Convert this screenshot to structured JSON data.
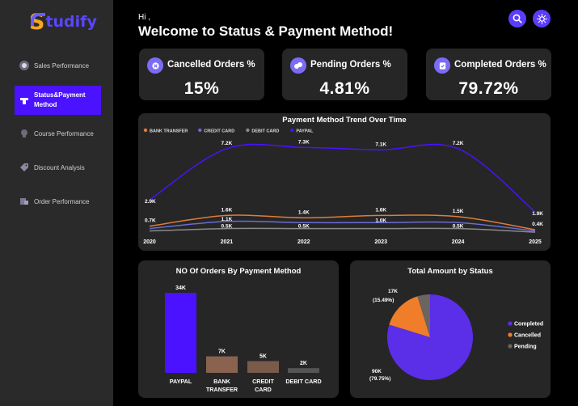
{
  "app": {
    "logo_letter": "S",
    "logo_rest": "tudify"
  },
  "sidebar": {
    "items": [
      {
        "label": "Sales Performance"
      },
      {
        "label_line1": "Status&Payment",
        "label_line2": "Method"
      },
      {
        "label": "Course Performance"
      },
      {
        "label": "Discount Analysis"
      },
      {
        "label": "Order Performance"
      }
    ]
  },
  "header": {
    "greeting": "Hi ,",
    "title": "Welcome to Status & Payment Method!"
  },
  "kpis": [
    {
      "title": "Cancelled Orders %",
      "value": "15%"
    },
    {
      "title": "Pending Orders %",
      "value": "4.81%"
    },
    {
      "title": "Completed Orders %",
      "value": "79.72%"
    }
  ],
  "colors": {
    "accent": "#4a12ff",
    "paypal": "#4a12ff",
    "bank_transfer": "#e07b39",
    "credit_card": "#6b6bd6",
    "debit_card": "#8a8a8a",
    "completed": "#5b2ee8",
    "cancelled": "#f07d2a",
    "pending": "#6b6460"
  },
  "chart_data": [
    {
      "type": "line",
      "title": "Payment Method Trend Over Time",
      "x": [
        "2020",
        "2021",
        "2022",
        "2023",
        "2024",
        "2025"
      ],
      "series": [
        {
          "name": "BANK TRANSFER",
          "values": [
            0.7,
            1.6,
            1.4,
            1.6,
            1.5,
            0.4
          ],
          "labels": [
            "0.7K",
            "1.6K",
            "1.4K",
            "1.6K",
            "1.5K",
            "0.4K"
          ]
        },
        {
          "name": "CREDIT CARD",
          "values": [
            0.5,
            1.1,
            1.0,
            1.0,
            1.0,
            0.3
          ],
          "labels": [
            "",
            "1.1K",
            "",
            "1.0K",
            "",
            ""
          ]
        },
        {
          "name": "DEBIT CARD",
          "values": [
            0.3,
            0.5,
            0.5,
            0.5,
            0.5,
            0.2
          ],
          "labels": [
            "",
            "0.5K",
            "0.5K",
            "",
            "0.5K",
            ""
          ]
        },
        {
          "name": "PAYPAL",
          "values": [
            2.9,
            7.2,
            7.3,
            7.1,
            7.2,
            1.9
          ],
          "labels": [
            "2.9K",
            "7.2K",
            "7.3K",
            "7.1K",
            "7.2K",
            "1.9K"
          ]
        }
      ],
      "ylim": [
        0,
        8
      ]
    },
    {
      "type": "bar",
      "title": "NO Of Orders By Payment Method",
      "categories": [
        "PAYPAL",
        "BANK TRANSFER",
        "CREDIT CARD",
        "DEBIT CARD"
      ],
      "category_lines": [
        [
          "PAYPAL"
        ],
        [
          "BANK",
          "TRANSFER"
        ],
        [
          "CREDIT",
          "CARD"
        ],
        [
          "DEBIT CARD"
        ]
      ],
      "values": [
        34,
        7,
        5,
        2
      ],
      "labels": [
        "34K",
        "7K",
        "5K",
        "2K"
      ],
      "colors": [
        "#4a12ff",
        "#8a6350",
        "#7a5a4a",
        "#555555"
      ]
    },
    {
      "type": "pie",
      "title": "Total Amount by Status",
      "slices": [
        {
          "name": "Completed",
          "value": 90,
          "percent": 79.75,
          "label": "90K",
          "pct_label": "(79.75%)"
        },
        {
          "name": "Cancelled",
          "value": 17,
          "percent": 15.49,
          "label": "17K",
          "pct_label": "(15.49%)"
        },
        {
          "name": "Pending",
          "value": 5.4,
          "percent": 4.76
        }
      ],
      "legend": "right"
    }
  ]
}
